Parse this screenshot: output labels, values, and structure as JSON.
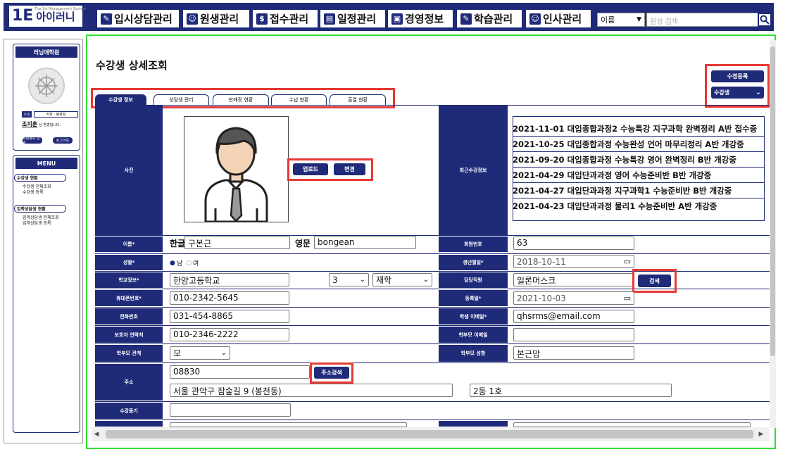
{
  "app": {
    "logo_mark": "1E",
    "logo_name": "아이러니",
    "logo_tagline": "The 1st Management System"
  },
  "topmenu": [
    {
      "icon": "✎",
      "label": "입시상담관리"
    },
    {
      "icon": "☺",
      "label": "원생관리"
    },
    {
      "icon": "$",
      "label": "접수관리"
    },
    {
      "icon": "▤",
      "label": "일정관리"
    },
    {
      "icon": "▣",
      "label": "경영정보"
    },
    {
      "icon": "✎",
      "label": "학습관리"
    },
    {
      "icon": "☺",
      "label": "인사관리"
    }
  ],
  "search": {
    "type": "이름",
    "placeholder": "원생 검색"
  },
  "sidebar": {
    "academy": "러닝에학원",
    "role_label": "소속",
    "branch": "지방 · 평창점",
    "user_name": "조지훈",
    "user_suffix": "님 환영합니다.",
    "btn_info": "회원정보 변경",
    "btn_logout": "로그아웃",
    "menu_title": "MENU",
    "groups": [
      {
        "label": "수강생 현황",
        "links": [
          "수강생 전체조회",
          "수강생 등록"
        ]
      },
      {
        "label": "입학상담생 현황",
        "links": [
          "입학상담생 전체조회",
          "입학상담생 등록"
        ]
      }
    ]
  },
  "page": {
    "title": "수강생 상세조회",
    "btn_register": "수정등록",
    "status_select": "수강생"
  },
  "tabs": [
    "수강생 정보",
    "상담생 관리",
    "반배정 현황",
    "수납 현황",
    "출결 현황"
  ],
  "photo": {
    "label": "사진",
    "btn_upload": "업로드",
    "btn_change": "변경"
  },
  "history": {
    "label": "최근수강정보",
    "items": [
      "2021-11-01 대입종합과정2 수능특강 지구과학 완벽정리 A반 접수중",
      "2021-10-25 대입종합과정 수능완성 언어 마무리정리 A반 개강중",
      "2021-09-20 대입종합과정 수능특강 영어 완벽정리 B반 개강중",
      "2021-04-29 대입단과과정 영어 수능준비반 B반 개강중",
      "2021-04-27 대입단과과정 지구과학1 수능준비반 B반 개강중",
      "2021-04-23 대입단과과정 물리1 수능준비반 A반 개강중"
    ]
  },
  "form": {
    "name_label": "이름*",
    "korean_label": "한글",
    "korean_value": "구본근",
    "english_label": "영문",
    "english_value": "bongean",
    "gender_label": "성별*",
    "gender_male": "남",
    "gender_female": "여",
    "school_label": "학교정보*",
    "school_value": "한양고등학교",
    "grade_value": "3",
    "school_status": "재학",
    "mobile_label": "휴대폰번호*",
    "mobile_value": "010-2342-5645",
    "home_label": "전화번호",
    "home_value": "031-454-8865",
    "guardian_phone_label": "보호자 연락처",
    "guardian_phone_value": "010-2346-2222",
    "relation_label": "학부모 관계",
    "relation_value": "모",
    "address_label": "주소",
    "zipcode": "08830",
    "btn_address": "주소검색",
    "address1": "서울 관악구 잠숲길 9 (봉천동)",
    "address2": "2동 1호",
    "motive_label": "수강동기",
    "member_no_label": "회원번호",
    "member_no": "63",
    "birth_label": "생년월일*",
    "birth_value": "2018-10-11",
    "manager_label": "담당직원",
    "manager_value": "일론머스크",
    "btn_search": "검색",
    "reg_date_label": "등록일*",
    "reg_date_value": "2021-10-03",
    "student_email_label": "학생 이메일*",
    "student_email_value": "qhsrms@email.com",
    "parent_email_label": "학부모 이메일",
    "parent_name_label": "학부모 성함",
    "parent_name_value": "본근맘"
  }
}
